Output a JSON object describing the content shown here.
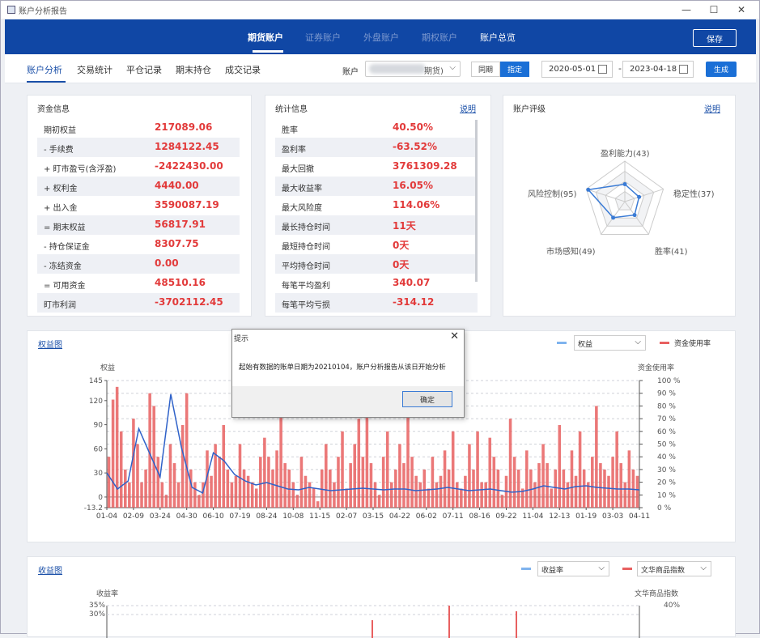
{
  "window": {
    "title": "账户分析报告",
    "min": "—",
    "max": "☐",
    "close": "✕"
  },
  "topnav": {
    "tabs": [
      {
        "label": "期货账户",
        "active": true
      },
      {
        "label": "证券账户",
        "active": false
      },
      {
        "label": "外盘账户",
        "active": false
      },
      {
        "label": "期权账户",
        "active": false
      },
      {
        "label": "账户总览",
        "active": false
      }
    ],
    "save": "保存"
  },
  "subnav": {
    "tabs": [
      "账户分析",
      "交易统计",
      "平仓记录",
      "期末持仓",
      "成交记录"
    ],
    "account_label": "账户",
    "account_value_suffix": "期货)",
    "period_same": "同期",
    "period_custom": "指定",
    "date_from": "2020-05-01",
    "date_sep": "-",
    "date_to": "2023-04-18",
    "generate": "生成"
  },
  "funds": {
    "title": "资金信息",
    "rows": [
      {
        "label": "期初权益",
        "value": "217089.06"
      },
      {
        "label": "- 手续费",
        "value": "1284122.45"
      },
      {
        "label": "+ 盯市盈亏(含浮盈)",
        "value": "-2422430.00"
      },
      {
        "label": "+ 权利金",
        "value": "4440.00"
      },
      {
        "label": "+ 出入金",
        "value": "3590087.19"
      },
      {
        "label": "= 期末权益",
        "value": "56817.91"
      },
      {
        "label": "- 持仓保证金",
        "value": "8307.75"
      },
      {
        "label": "- 冻结资金",
        "value": "0.00"
      },
      {
        "label": "= 可用资金",
        "value": "48510.16"
      },
      {
        "label": "盯市利润",
        "value": "-3702112.45"
      }
    ]
  },
  "stats": {
    "title": "统计信息",
    "link": "说明",
    "rows": [
      {
        "label": "胜率",
        "value": "40.50%"
      },
      {
        "label": "盈利率",
        "value": "-63.52%"
      },
      {
        "label": "最大回撤",
        "value": "3761309.28"
      },
      {
        "label": "最大收益率",
        "value": "16.05%"
      },
      {
        "label": "最大风险度",
        "value": "114.06%"
      },
      {
        "label": "最长持仓时间",
        "value": "11天"
      },
      {
        "label": "最短持仓时间",
        "value": "0天"
      },
      {
        "label": "平均持仓时间",
        "value": "0天"
      },
      {
        "label": "每笔平均盈利",
        "value": "340.07"
      },
      {
        "label": "每笔平均亏损",
        "value": "-314.12"
      }
    ]
  },
  "rating": {
    "title": "账户评级",
    "link": "说明",
    "axes": [
      {
        "label": "盈利能力(43)",
        "score": 43
      },
      {
        "label": "稳定性(37)",
        "score": 37
      },
      {
        "label": "胜率(41)",
        "score": 41
      },
      {
        "label": "市场感知(49)",
        "score": 49
      },
      {
        "label": "风险控制(95)",
        "score": 95
      }
    ],
    "color": "#3a7bd5"
  },
  "equity_chart": {
    "title": "权益图",
    "legend_left_select": "权益",
    "legend_right": "资金使用率",
    "left_axis_title": "权益",
    "right_axis_title": "资金使用率",
    "colors": {
      "line": "#2f62c9",
      "bar": "#e86060",
      "legend_line": "#7fb3ee"
    }
  },
  "return_chart": {
    "title": "收益图",
    "legend_left_select": "收益率",
    "legend_right_select": "文华商品指数",
    "left_axis_title": "收益率",
    "right_axis_title": "文华商品指数",
    "left_ticks": [
      "35%",
      "30%"
    ],
    "right_ticks": [
      "40%"
    ]
  },
  "chart_data": [
    {
      "type": "bar+line",
      "title": "权益图",
      "ylabel": "权益",
      "y2label": "资金使用率",
      "ylim": [
        -13.2,
        145
      ],
      "yticks": [
        "145",
        "120",
        "90",
        "60",
        "30",
        "0",
        "-13.2"
      ],
      "y2lim": [
        0,
        100
      ],
      "y2ticks": [
        "100 %",
        "90 %",
        "80 %",
        "70 %",
        "60 %",
        "50 %",
        "40 %",
        "30 %",
        "20 %",
        "10 %",
        "0 %"
      ],
      "categories": [
        "01-04",
        "02-09",
        "03-24",
        "04-30",
        "06-10",
        "07-19",
        "08-24",
        "10-08",
        "11-15",
        "02-07",
        "03-15",
        "04-22",
        "06-02",
        "07-11",
        "08-16",
        "09-22",
        "11-04",
        "12-13",
        "01-19",
        "03-03",
        "04-11"
      ],
      "series": [
        {
          "name": "权益",
          "kind": "line",
          "values": [
            30,
            10,
            20,
            85,
            55,
            25,
            128,
            62,
            12,
            5,
            55,
            45,
            28,
            20,
            15,
            18,
            14,
            10,
            9,
            12,
            10,
            8,
            9,
            10,
            11,
            10,
            9,
            10,
            10,
            8,
            9,
            10,
            12,
            10,
            8,
            9,
            10,
            8,
            6,
            7,
            10,
            14,
            12,
            10,
            13,
            14,
            12,
            11,
            10,
            10,
            9
          ]
        },
        {
          "name": "资金使用率",
          "kind": "bar",
          "unit": "%",
          "values": [
            40,
            85,
            95,
            60,
            30,
            20,
            70,
            50,
            20,
            30,
            90,
            80,
            40,
            20,
            10,
            50,
            35,
            20,
            65,
            90,
            30,
            20,
            10,
            20,
            45,
            25,
            50,
            40,
            65,
            30,
            20,
            25,
            50,
            30,
            25,
            20,
            15,
            40,
            55,
            40,
            30,
            45,
            85,
            35,
            30,
            20,
            10,
            40,
            25,
            20,
            15,
            5,
            30,
            50,
            30,
            20,
            40,
            60,
            15,
            35,
            50,
            70,
            40,
            80,
            35,
            20,
            10,
            40,
            60,
            20,
            30,
            50,
            35,
            80,
            40,
            25,
            20,
            30,
            15,
            40,
            20,
            25,
            45,
            30,
            60,
            20,
            15,
            25,
            50,
            30,
            60,
            20,
            20,
            55,
            40,
            30,
            10,
            25,
            70,
            40,
            30,
            15,
            45,
            30,
            20,
            35,
            50,
            35,
            15,
            30,
            65,
            30,
            20,
            45,
            25,
            60,
            30,
            20,
            40,
            80,
            35,
            30,
            25,
            40,
            60,
            35,
            20,
            45,
            30,
            25
          ]
        }
      ]
    },
    {
      "type": "bar+line",
      "title": "收益图",
      "ylabel": "收益率",
      "y2label": "文华商品指数",
      "yticks": [
        "35%",
        "30%"
      ],
      "y2ticks": [
        "40%"
      ]
    }
  ],
  "dialog": {
    "title": "提示",
    "close": "✕",
    "message": "起始有数据的账单日期为20210104，账户分析报告从该日开始分析",
    "ok": "确定"
  }
}
